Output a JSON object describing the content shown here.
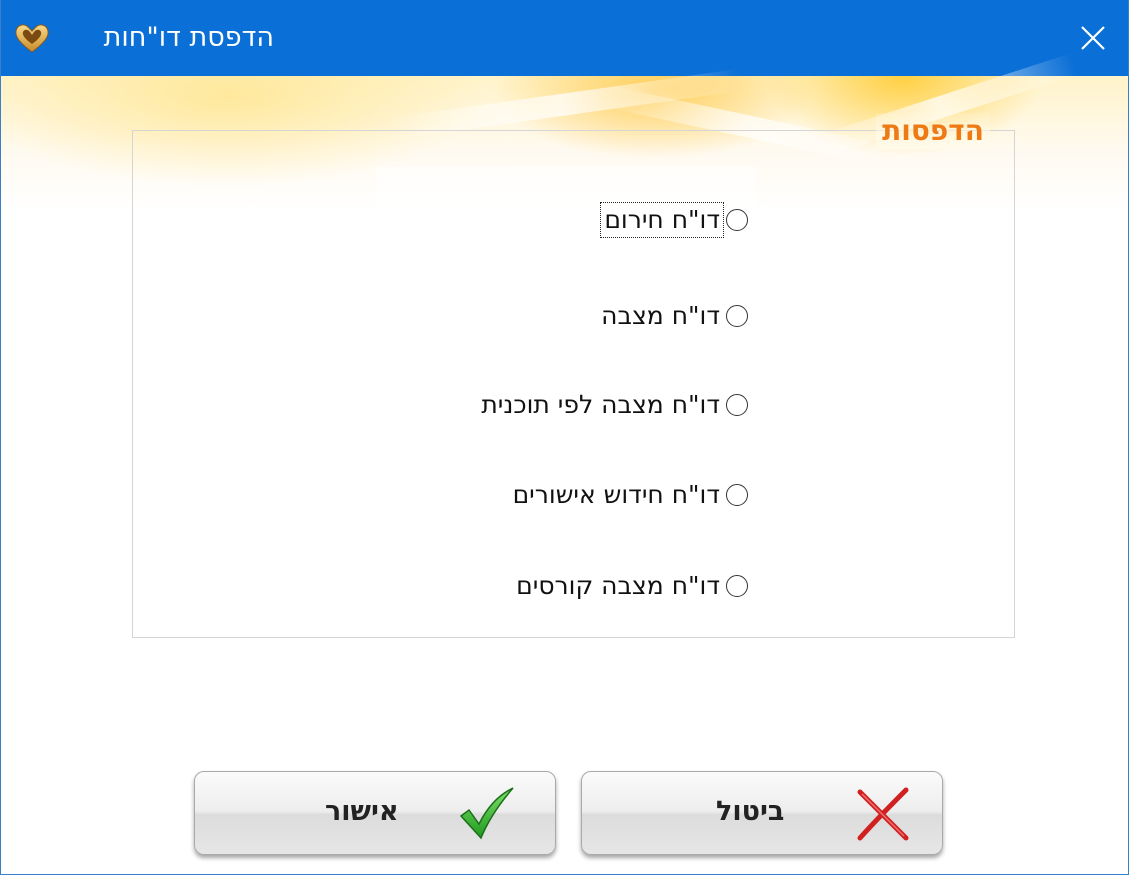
{
  "window": {
    "title": "הדפסת דו\"חות"
  },
  "titlebar": {
    "color": "#0a6fd6",
    "app_icon": "heart-logo-icon",
    "close_icon": "close-icon"
  },
  "group": {
    "title": "הדפסות",
    "title_color": "#ee7a16"
  },
  "options": [
    {
      "label": "דו\"ח חירום",
      "selected": false,
      "focused": true
    },
    {
      "label": "דו\"ח מצבה",
      "selected": false,
      "focused": false
    },
    {
      "label": "דו\"ח מצבה לפי תוכנית",
      "selected": false,
      "focused": false
    },
    {
      "label": "דו\"ח חידוש אישורים",
      "selected": false,
      "focused": false
    },
    {
      "label": "דו\"ח מצבה קורסים",
      "selected": false,
      "focused": false
    }
  ],
  "buttons": {
    "ok_label": "אישור",
    "ok_icon": "checkmark-icon",
    "cancel_label": "ביטול",
    "cancel_icon": "red-x-icon"
  }
}
